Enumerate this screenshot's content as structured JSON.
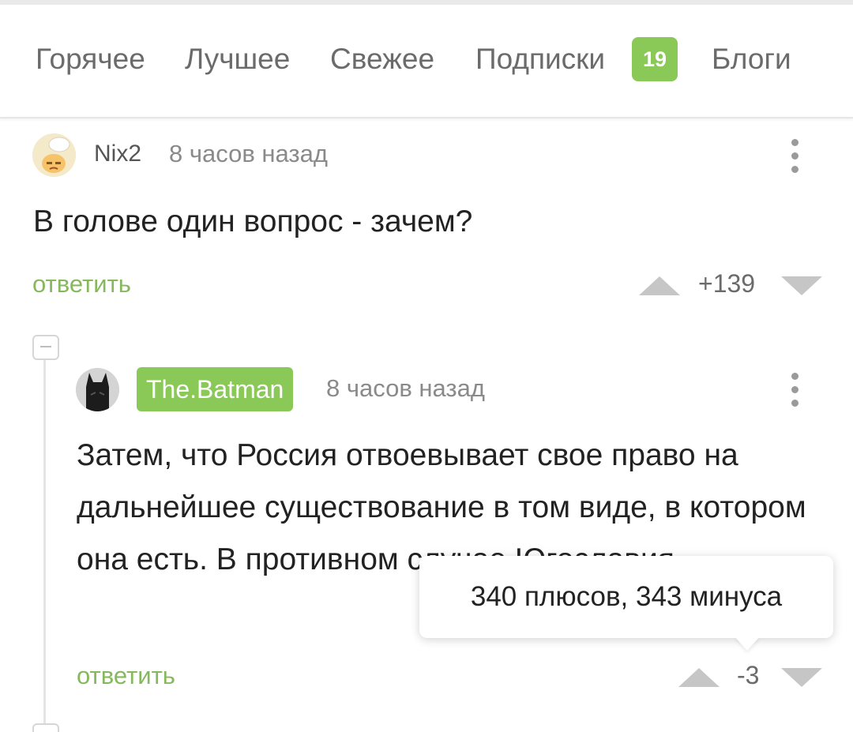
{
  "nav": {
    "items": [
      {
        "label": "Горячее"
      },
      {
        "label": "Лучшее"
      },
      {
        "label": "Свежее"
      },
      {
        "label": "Подписки",
        "badge": "19"
      },
      {
        "label": "Блоги"
      }
    ],
    "badge_color": "#8ac858"
  },
  "comments": [
    {
      "author": "Nix2",
      "time": "8 часов назад",
      "text": "В голове один вопрос - зачем?",
      "reply_label": "ответить",
      "rating": "+139",
      "avatar_icon": "avatar-icon"
    },
    {
      "author": "The.Batman",
      "time": "8 часов назад",
      "text": "Затем, что Россия отвоевывает свое право на дальнейшее существование в том виде, в котором она есть. В противном случае Югославия.",
      "reply_label": "ответить",
      "rating": "-3",
      "avatar_icon": "batman-avatar-icon"
    }
  ],
  "tooltip": {
    "text": "340 плюсов, 343 минуса"
  },
  "colors": {
    "accent_green": "#8ac858",
    "reply_green": "#86b95d"
  }
}
